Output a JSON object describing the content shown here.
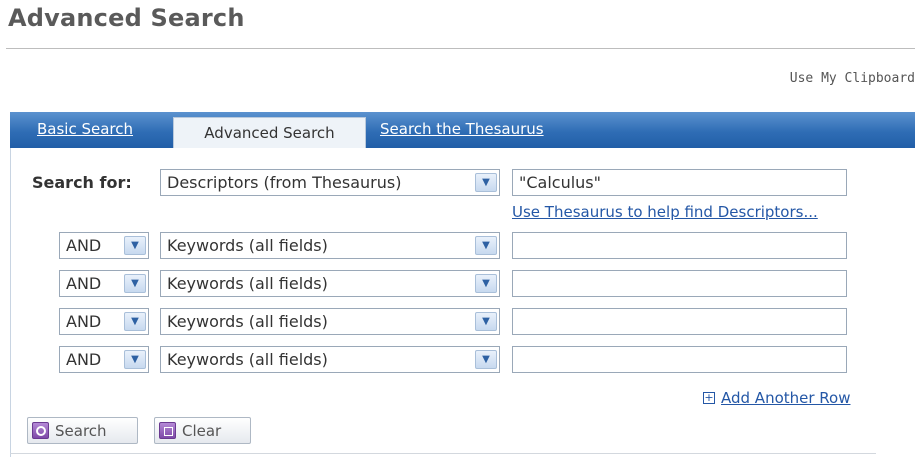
{
  "page": {
    "title": "Advanced Search",
    "clipboard_link": "Use My Clipboard"
  },
  "tabs": [
    {
      "label": "Basic Search",
      "active": false
    },
    {
      "label": "Advanced Search",
      "active": true
    },
    {
      "label": "Search the Thesaurus",
      "active": false
    }
  ],
  "search": {
    "search_for_label": "Search for:",
    "primary_field": "Descriptors (from Thesaurus)",
    "primary_value": "\"Calculus\"",
    "thesaurus_help_link": "Use Thesaurus to help find Descriptors...",
    "rows": [
      {
        "operator": "AND",
        "field": "Keywords (all fields)",
        "value": ""
      },
      {
        "operator": "AND",
        "field": "Keywords (all fields)",
        "value": ""
      },
      {
        "operator": "AND",
        "field": "Keywords (all fields)",
        "value": ""
      },
      {
        "operator": "AND",
        "field": "Keywords (all fields)",
        "value": ""
      }
    ],
    "add_row_label": "Add Another Row"
  },
  "buttons": {
    "search_label": "Search",
    "clear_label": "Clear"
  },
  "colors": {
    "tab_bar": "#2f6db5",
    "link": "#2457a6",
    "button_icon": "#7e4aa8"
  }
}
